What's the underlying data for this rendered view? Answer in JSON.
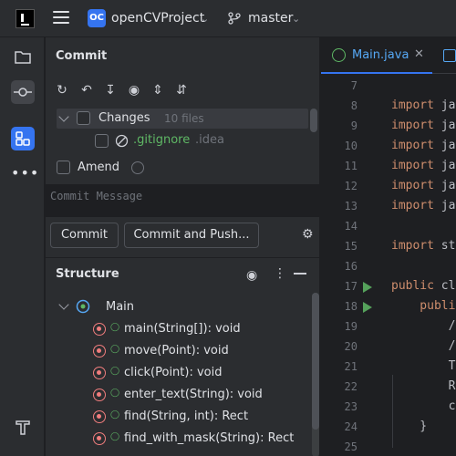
{
  "header": {
    "project_badge": "OC",
    "project_name": "openCVProject",
    "branch_name": "master"
  },
  "toolstrip": {
    "more_label": "•••"
  },
  "commit_panel": {
    "title": "Commit",
    "changes": {
      "label": "Changes",
      "count": "10 files"
    },
    "file": {
      "name": ".gitignore",
      "dir": ".idea"
    },
    "amend_label": "Amend",
    "message_placeholder": "Commit Message",
    "commit_button": "Commit",
    "commit_push_button": "Commit and Push..."
  },
  "structure_panel": {
    "title": "Structure",
    "root": "Main",
    "members": [
      "main(String[]): void",
      "move(Point): void",
      "click(Point): void",
      "enter_text(String): void",
      "find(String, int): Rect",
      "find_with_mask(String): Rect"
    ]
  },
  "editor": {
    "tab_label": "Main.java",
    "lines": [
      {
        "num": "7",
        "text": ""
      },
      {
        "num": "8",
        "kw": "import",
        "text": " ja"
      },
      {
        "num": "9",
        "kw": "import",
        "text": " ja"
      },
      {
        "num": "10",
        "kw": "import",
        "text": " ja"
      },
      {
        "num": "11",
        "kw": "import",
        "text": " ja"
      },
      {
        "num": "12",
        "kw": "import",
        "text": " ja"
      },
      {
        "num": "13",
        "kw": "import",
        "text": " ja"
      },
      {
        "num": "14",
        "text": ""
      },
      {
        "num": "15",
        "kw": "import",
        "text": " st"
      },
      {
        "num": "16",
        "text": ""
      },
      {
        "num": "17",
        "kw": "public",
        "text": " cl"
      },
      {
        "num": "18",
        "kw": "    publi",
        "text": ""
      },
      {
        "num": "19",
        "text": "        /"
      },
      {
        "num": "20",
        "text": "        /"
      },
      {
        "num": "21",
        "text": "        T"
      },
      {
        "num": "22",
        "text": "        R"
      },
      {
        "num": "23",
        "text": "        c"
      },
      {
        "num": "24",
        "text": "    }"
      },
      {
        "num": "25",
        "text": ""
      }
    ]
  }
}
